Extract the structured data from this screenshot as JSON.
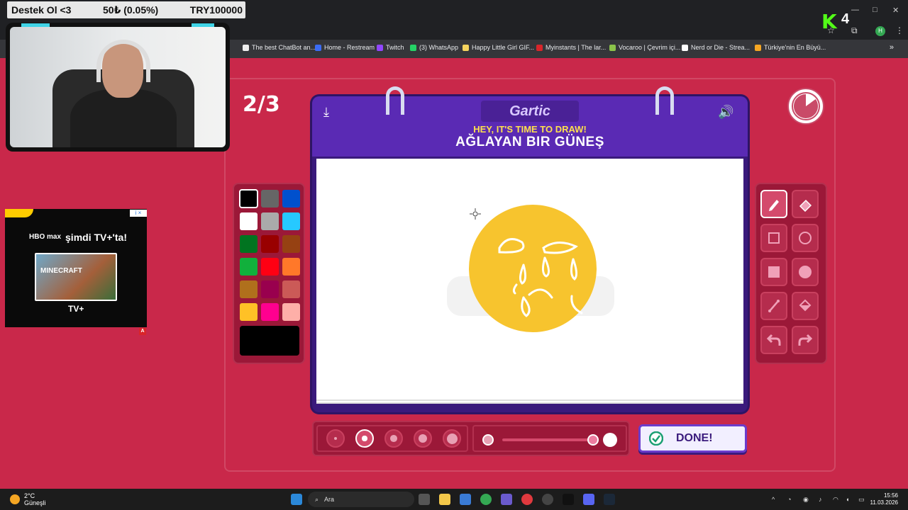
{
  "stream_overlay": {
    "left_text": "Destek Ol <3",
    "middle_text": "50₺ (0.05%)",
    "right_text": "TRY100000"
  },
  "browser": {
    "bookmarks": [
      {
        "label": "The best ChatBot an...",
        "color": "#eeeeee"
      },
      {
        "label": "Home - Restream",
        "color": "#3b6cf5"
      },
      {
        "label": "Twitch",
        "color": "#9146ff"
      },
      {
        "label": "(3) WhatsApp",
        "color": "#25d366"
      },
      {
        "label": "Happy Little Girl GIF...",
        "color": "#f4d35e"
      },
      {
        "label": "Myinstants | The lar...",
        "color": "#d9252a"
      },
      {
        "label": "Vocaroo | Çevrim içi...",
        "color": "#8bc34a"
      },
      {
        "label": "Nerd or Die - Strea...",
        "color": "#ffffff"
      },
      {
        "label": "Türkiye'nin En Büyü...",
        "color": "#f5a623"
      }
    ],
    "more_icon": "chevron-right-double",
    "profile_initial": "H"
  },
  "kick_overlay": {
    "logo": "K",
    "count": "4"
  },
  "game": {
    "round_counter": "2/3",
    "logo_text": "Gartic",
    "subtitle": "HEY, IT'S TIME TO DRAW!",
    "word": "AĞLAYAN BIR GÜNEŞ",
    "timer_remaining_fraction": 0.85,
    "done_label": "DONE!",
    "selected_color": "#000000",
    "palette": [
      "#000000",
      "#666666",
      "#0050cd",
      "#ffffff",
      "#aaaaaa",
      "#26c9ff",
      "#017420",
      "#990000",
      "#964112",
      "#11b03c",
      "#ff0013",
      "#ff7829",
      "#b0701c",
      "#99004e",
      "#cb5a57",
      "#ffc126",
      "#ff008f",
      "#feafa8"
    ],
    "tools": [
      "pencil",
      "eraser",
      "rectangle",
      "ellipse",
      "filled-rectangle",
      "filled-ellipse",
      "line",
      "bucket",
      "undo",
      "redo"
    ],
    "selected_tool": "pencil",
    "brush_sizes": [
      1,
      2,
      3,
      4,
      5
    ],
    "selected_brush_size": 2,
    "opacity_fraction": 1.0
  },
  "ad": {
    "brand": "HBO max",
    "headline": "şimdi TV+'ta!",
    "image_title": "MINECRAFT",
    "footer_logo": "TV+",
    "info_label": "i ×",
    "badge": "A"
  },
  "taskbar": {
    "weather_temp": "2°C",
    "weather_desc": "Güneşli",
    "search_placeholder": "Ara",
    "time": "15:56",
    "date": "11.03.2026"
  }
}
